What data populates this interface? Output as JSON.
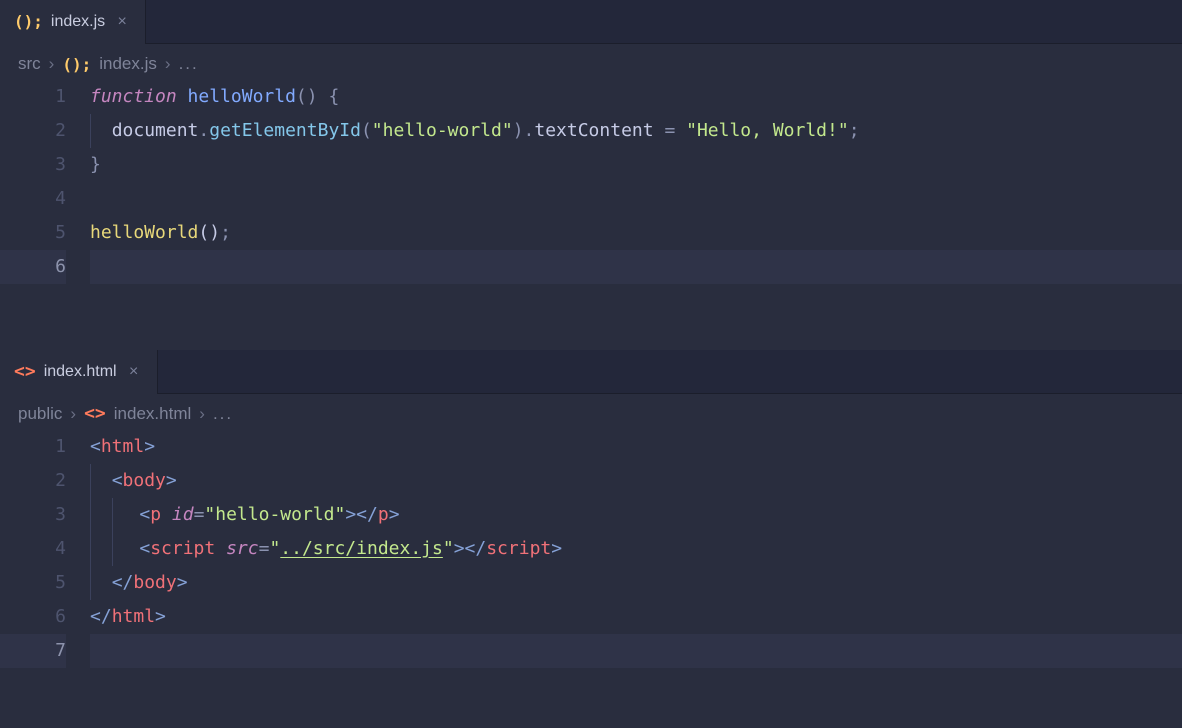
{
  "colors": {
    "bg": "#292d3e",
    "tabbar": "#23273a",
    "gutter": "#4e546e",
    "currentLine": "#2f3348",
    "jsIcon": "#ffcb6b",
    "htmlIcon": "#ff7b5c"
  },
  "top": {
    "tab": {
      "iconGlyph": "();",
      "label": "index.js",
      "close": "×"
    },
    "breadcrumb": {
      "seg1": "src",
      "chev": "›",
      "iconGlyph": "();",
      "seg2": "index.js",
      "ellipsis": "..."
    },
    "lineNumbers": [
      "1",
      "2",
      "3",
      "4",
      "5",
      "6"
    ],
    "code": {
      "l1": {
        "kw": "function",
        "sp1": " ",
        "fn": "helloWorld",
        "paren": "()",
        "sp2": " ",
        "brace": "{"
      },
      "l2": {
        "indent": "  ",
        "obj": "document",
        "dot1": ".",
        "method": "getElementById",
        "lp": "(",
        "arg": "\"hello-world\"",
        "rp": ")",
        "dot2": ".",
        "prop": "textContent",
        "sp1": " ",
        "eq": "=",
        "sp2": " ",
        "val": "\"Hello, World!\"",
        "semi": ";"
      },
      "l3": {
        "brace": "}"
      },
      "l4": "",
      "l5": {
        "fn": "helloWorld",
        "paren": "()",
        "semi": ";"
      },
      "l6": ""
    }
  },
  "bottom": {
    "tab": {
      "iconGlyph": "<>",
      "label": "index.html",
      "close": "×"
    },
    "breadcrumb": {
      "seg1": "public",
      "chev": "›",
      "iconGlyph": "<>",
      "seg2": "index.html",
      "ellipsis": "..."
    },
    "lineNumbers": [
      "1",
      "2",
      "3",
      "4",
      "5",
      "6",
      "7"
    ],
    "code": {
      "l1": {
        "lt": "<",
        "tag": "html",
        "gt": ">"
      },
      "l2": {
        "indent": "  ",
        "lt": "<",
        "tag": "body",
        "gt": ">"
      },
      "l3": {
        "indent": "    ",
        "lt": "<",
        "tag": "p",
        "sp": " ",
        "attr": "id",
        "eq": "=",
        "val": "\"hello-world\"",
        "gt1": ">",
        "lts": "</",
        "tagc": "p",
        "gt2": ">"
      },
      "l4": {
        "indent": "    ",
        "lt": "<",
        "tag": "script",
        "sp": " ",
        "attr": "src",
        "eq": "=",
        "q1": "\"",
        "val": "../src/index.js",
        "q2": "\"",
        "gt1": ">",
        "lts": "</",
        "tagc": "script",
        "gt2": ">"
      },
      "l5": {
        "indent": "  ",
        "lts": "</",
        "tag": "body",
        "gt": ">"
      },
      "l6": {
        "lts": "</",
        "tag": "html",
        "gt": ">"
      },
      "l7": ""
    }
  }
}
